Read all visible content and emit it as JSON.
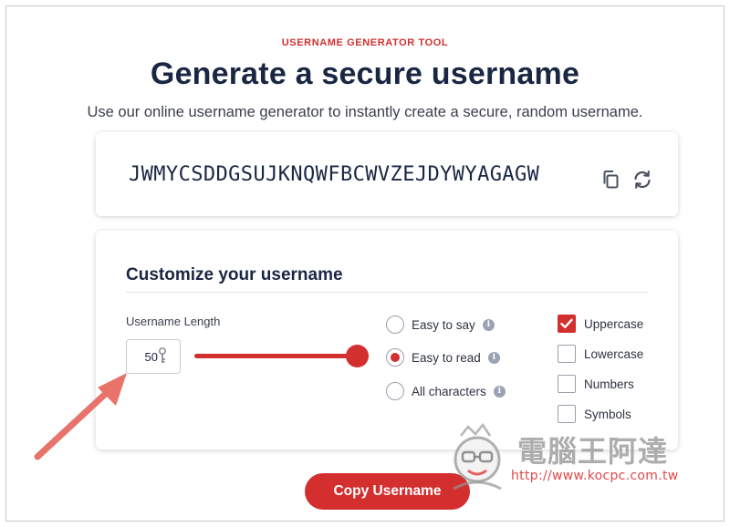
{
  "header": {
    "eyebrow": "USERNAME GENERATOR TOOL",
    "title": "Generate a secure username",
    "subtitle": "Use our online username generator to instantly create a secure, random username."
  },
  "output": {
    "username": "JWMYCSDDGSUJKNQWFBCWVZEJDYWYAGAGW",
    "copy_icon": "copy-icon",
    "refresh_icon": "refresh-icon"
  },
  "customize": {
    "title": "Customize your username",
    "length_label": "Username Length",
    "length_value": "50",
    "slider_level": 1.0,
    "character_modes": [
      {
        "label": "Easy to say",
        "selected": false,
        "info_icon": "info-icon"
      },
      {
        "label": "Easy to read",
        "selected": true,
        "info_icon": "info-icon"
      },
      {
        "label": "All characters",
        "selected": false,
        "info_icon": "info-icon"
      }
    ],
    "character_types": [
      {
        "label": "Uppercase",
        "checked": true
      },
      {
        "label": "Lowercase",
        "checked": false
      },
      {
        "label": "Numbers",
        "checked": false
      },
      {
        "label": "Symbols",
        "checked": false
      }
    ]
  },
  "actions": {
    "copy_label": "Copy Username"
  },
  "watermark": {
    "brand": "電腦王阿達",
    "url": "http://www.kocpc.com.tw"
  },
  "colors": {
    "accent": "#d32f2f",
    "heading": "#1a2744",
    "arrow": "#e8736a"
  }
}
